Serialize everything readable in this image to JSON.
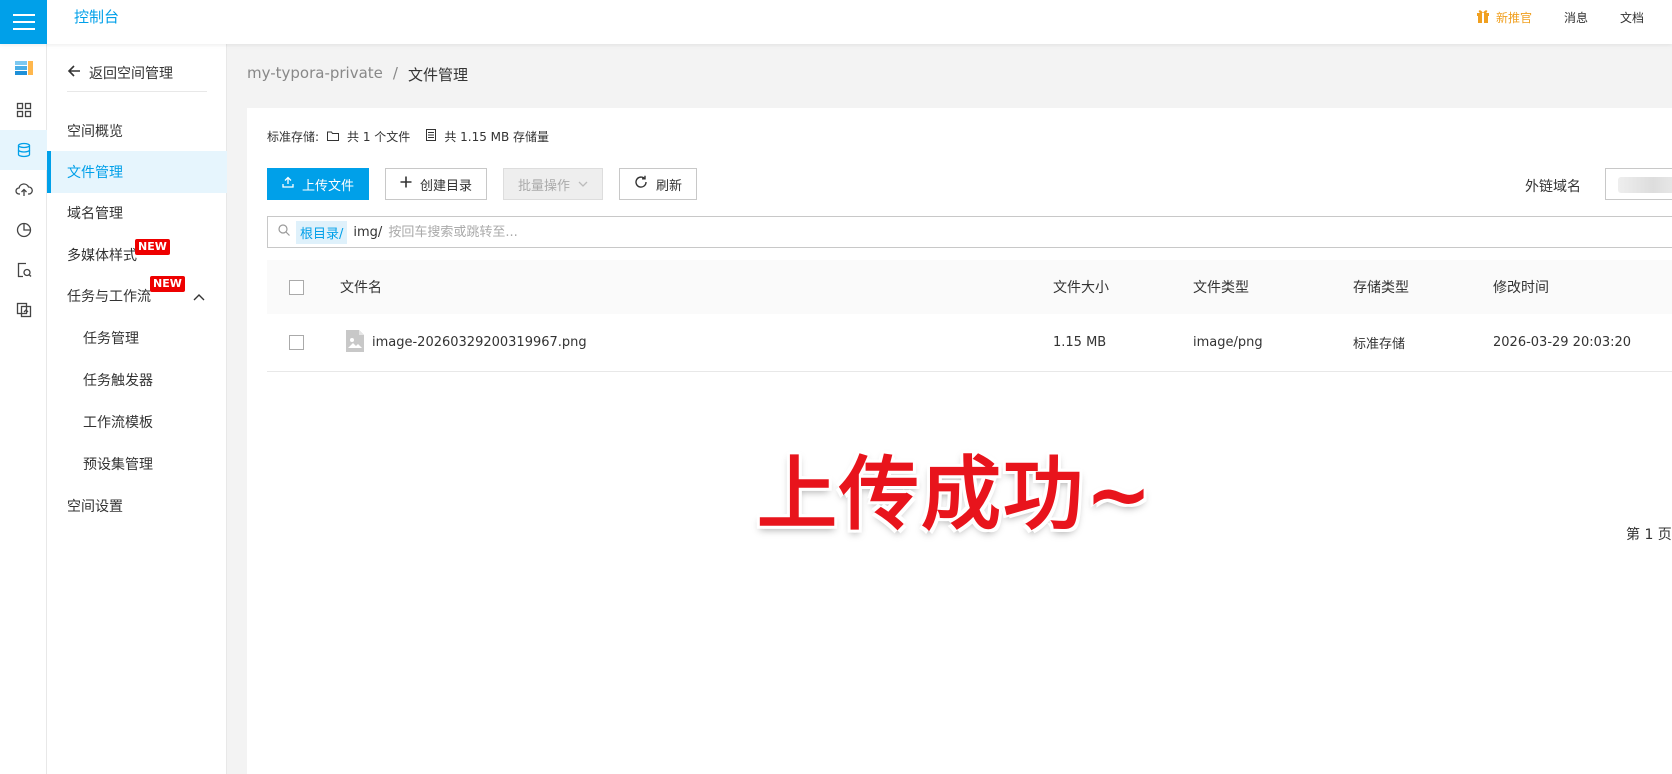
{
  "topbar": {
    "brand": "控制台",
    "gift_label": "新推官",
    "messages_label": "消息",
    "docs_label": "文档",
    "accent": "#00a0e9"
  },
  "rail": {
    "icons": [
      "storage-logo-icon",
      "grid-icon",
      "database-icon",
      "cloud-upload-icon",
      "pie-chart-icon",
      "file-search-icon",
      "sync-file-icon"
    ],
    "active_index": 2
  },
  "nav": {
    "back_label": "返回空间管理",
    "items": [
      {
        "label": "空间概览"
      },
      {
        "label": "文件管理"
      },
      {
        "label": "域名管理"
      },
      {
        "label": "多媒体样式",
        "badge": "NEW"
      },
      {
        "label": "任务与工作流",
        "badge": "NEW"
      },
      {
        "label": "任务管理"
      },
      {
        "label": "任务触发器"
      },
      {
        "label": "工作流模板"
      },
      {
        "label": "预设集管理"
      },
      {
        "label": "空间设置"
      }
    ]
  },
  "breadcrumb": {
    "bucket": "my-typora-private",
    "separator": "/",
    "current": "文件管理"
  },
  "storage": {
    "type_label": "标准存储:",
    "file_count": "共 1 个文件",
    "size": "共 1.15 MB 存储量"
  },
  "toolbar": {
    "upload_label": "上传文件",
    "mkdir_label": "创建目录",
    "batch_label": "批量操作",
    "refresh_label": "刷新",
    "domain_label": "外链域名"
  },
  "search": {
    "root_chip": "根目录/",
    "path": "img/",
    "placeholder": "按回车搜索或跳转至..."
  },
  "table": {
    "headers": {
      "name": "文件名",
      "size": "文件大小",
      "type": "文件类型",
      "storage": "存储类型",
      "modified": "修改时间"
    },
    "rows": [
      {
        "name": "image-20260329200319967.png",
        "size": "1.15 MB",
        "type": "image/png",
        "storage": "标准存储",
        "modified": "2026-03-29 20:03:20"
      }
    ]
  },
  "pagination": {
    "page_text": "第 1 页"
  },
  "overlay": {
    "text": "上传成功~",
    "color": "#e8141c"
  }
}
